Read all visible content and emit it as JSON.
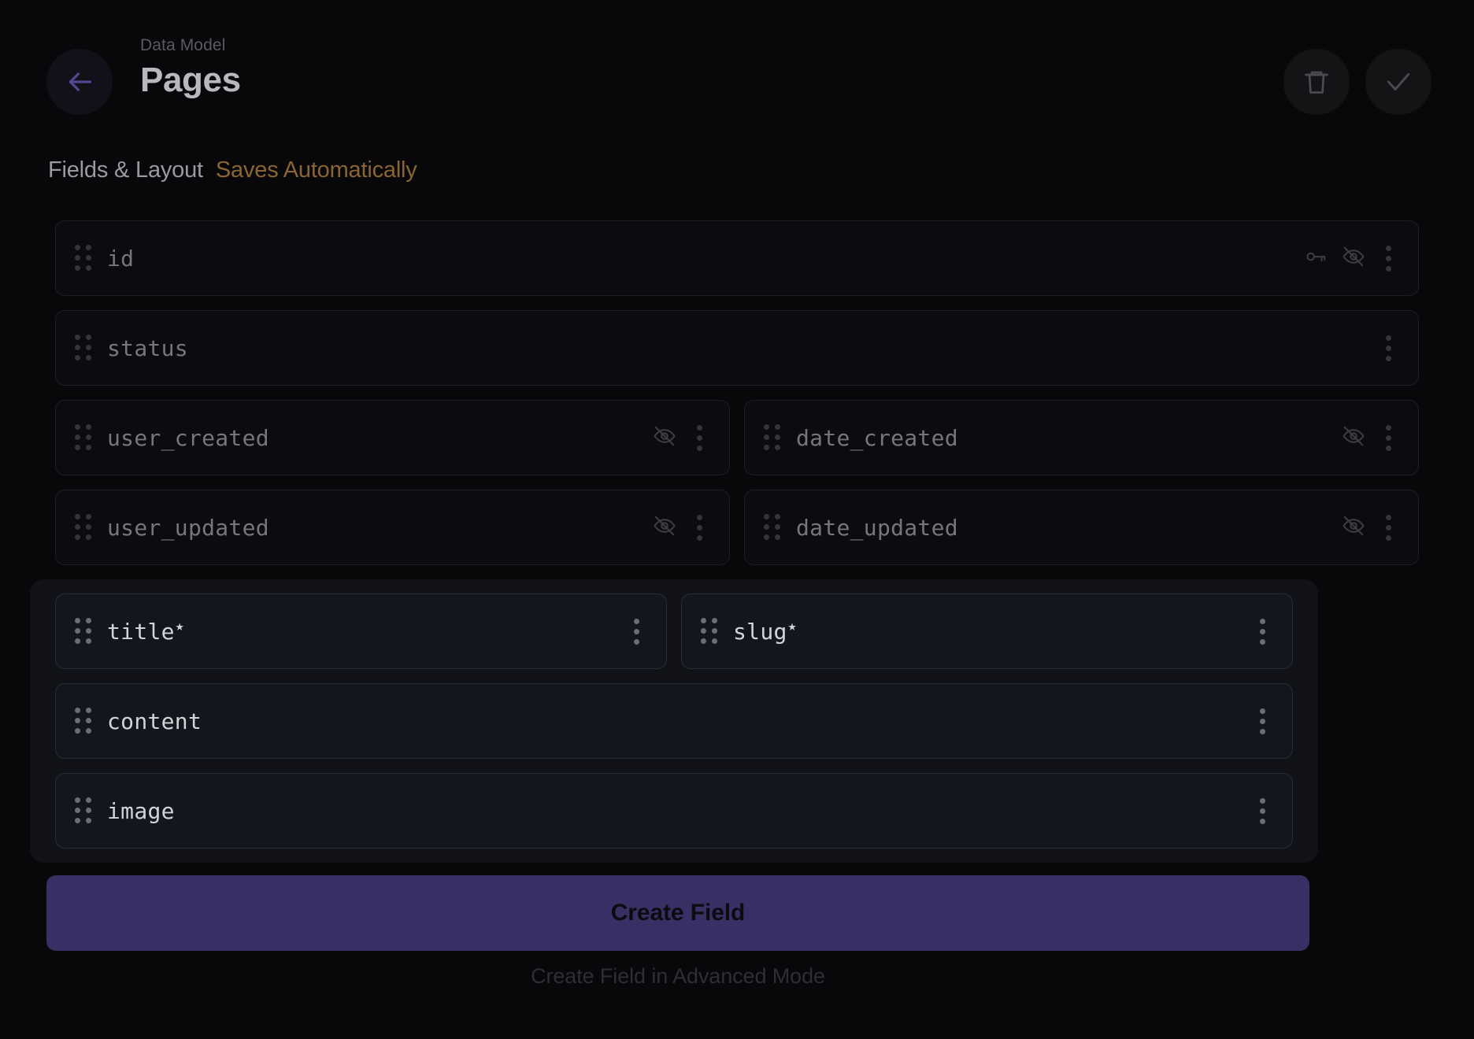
{
  "header": {
    "breadcrumb": "Data Model",
    "title": "Pages",
    "back_icon": "arrow-left-icon",
    "delete_icon": "trash-icon",
    "save_icon": "check-icon"
  },
  "section": {
    "title": "Fields & Layout",
    "note": "Saves Automatically"
  },
  "colors": {
    "background": "#08080a",
    "accent_purple": "#383065",
    "back_arrow": "#54468c",
    "autosave_note": "#8a6432",
    "row_background": "#0b0c0f",
    "group_background": "#101218",
    "group_row_background": "#14161d"
  },
  "fields": {
    "id": {
      "name": "id",
      "required": false
    },
    "status": {
      "name": "status",
      "required": false
    },
    "user_created": {
      "name": "user_created",
      "required": false
    },
    "date_created": {
      "name": "date_created",
      "required": false
    },
    "user_updated": {
      "name": "user_updated",
      "required": false
    },
    "date_updated": {
      "name": "date_updated",
      "required": false
    },
    "title": {
      "name": "title",
      "required": true,
      "required_mark": "★"
    },
    "slug": {
      "name": "slug",
      "required": true,
      "required_mark": "★"
    },
    "content": {
      "name": "content",
      "required": false
    },
    "image": {
      "name": "image",
      "required": false
    }
  },
  "icon_names": {
    "drag": "drag-handle-icon",
    "kebab": "more-options-icon",
    "key": "key-icon",
    "hidden": "eye-off-icon"
  },
  "footer": {
    "create_label": "Create Field",
    "advanced_label": "Create Field in Advanced Mode"
  }
}
